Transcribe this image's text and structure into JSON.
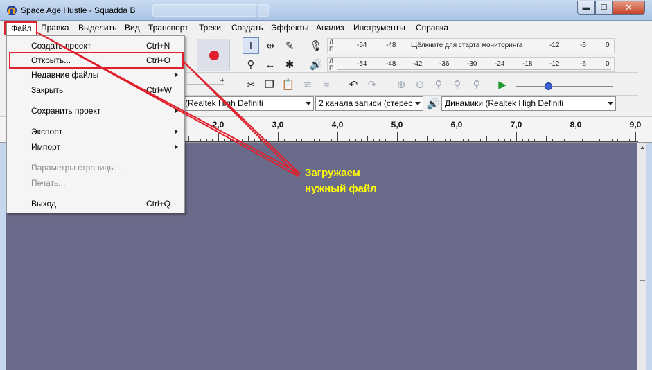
{
  "window": {
    "title": "Space Age Hustle - Squadda B",
    "buttons": {
      "minimize": "▬",
      "maximize": "☐",
      "close": "✕"
    }
  },
  "menubar": {
    "items": [
      "Файл",
      "Правка",
      "Выделить",
      "Вид",
      "Транспорт",
      "Треки",
      "Создать",
      "Эффекты",
      "Анализ",
      "Инструменты",
      "Справка"
    ]
  },
  "file_menu": {
    "items": [
      {
        "label": "Создать проект",
        "shortcut": "Ctrl+N"
      },
      {
        "label": "Открыть...",
        "shortcut": "Ctrl+O"
      },
      {
        "label": "Недавние файлы",
        "shortcut": ""
      },
      {
        "label": "Закрыть",
        "shortcut": "Ctrl+W"
      },
      {
        "label": "Сохранить проект",
        "shortcut": ""
      },
      {
        "label": "Экспорт",
        "shortcut": ""
      },
      {
        "label": "Импорт",
        "shortcut": ""
      },
      {
        "label": "Параметры страницы...",
        "shortcut": ""
      },
      {
        "label": "Печать...",
        "shortcut": ""
      },
      {
        "label": "Выход",
        "shortcut": "Ctrl+Q"
      }
    ]
  },
  "meters": {
    "record": {
      "l": "Л",
      "r": "П",
      "ticks": [
        "-54",
        "-48",
        "Щёлкните для старта мониторинга",
        "-12",
        "-6",
        "0"
      ]
    },
    "playback": {
      "l": "Л",
      "r": "П",
      "ticks": [
        "-54",
        "-48",
        "-42",
        "-36",
        "-30",
        "-24",
        "-18",
        "-12",
        "-6",
        "0"
      ]
    }
  },
  "devices": {
    "input_device": "(Realtek High Definiti",
    "channels": "2 канала записи (стерес",
    "output_device": "Динамики (Realtek High Definiti"
  },
  "ruler": {
    "labels": [
      "2,0",
      "3,0",
      "4,0",
      "5,0",
      "6,0",
      "7,0",
      "8,0",
      "9,0"
    ]
  },
  "annotation": {
    "line1": "Загружаем",
    "line2": "нужный файл"
  },
  "colors": {
    "highlight": "#e0202c",
    "annotation": "#ffff00",
    "track_bg": "#6a6b8a",
    "record": "#e0202c",
    "play": "#1f9a2c"
  }
}
